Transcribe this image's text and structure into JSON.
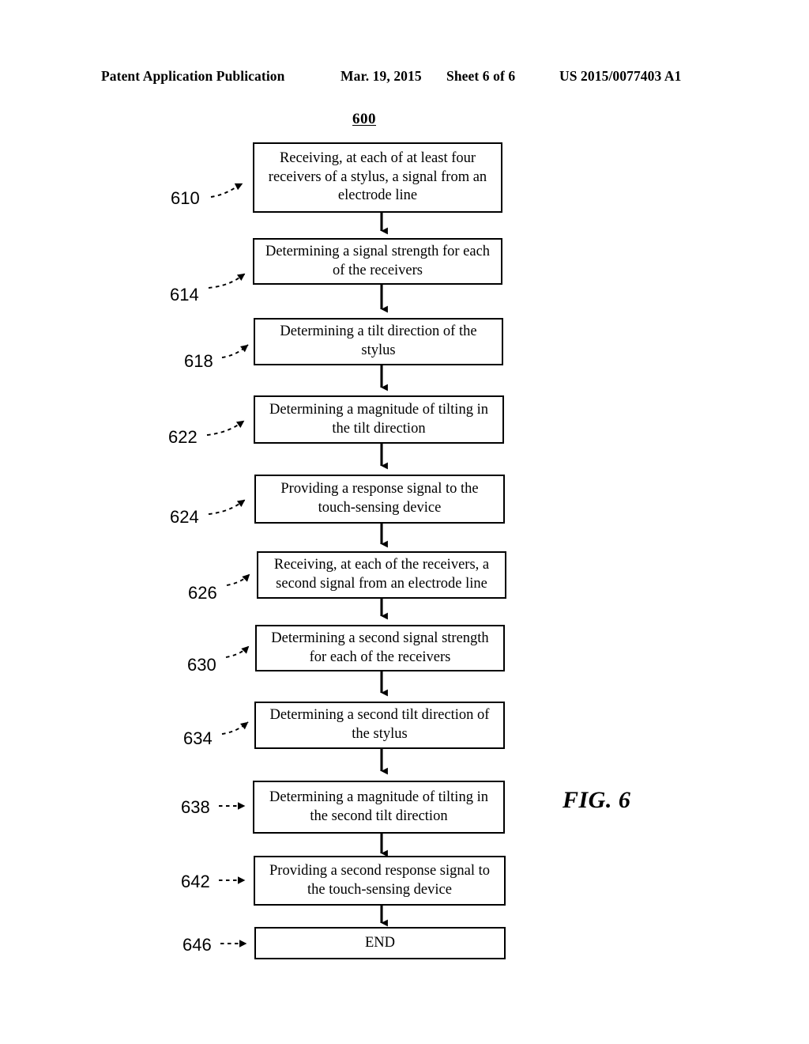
{
  "header": {
    "left": "Patent Application Publication",
    "date": "Mar. 19, 2015",
    "sheet": "Sheet 6 of 6",
    "publication_number": "US 2015/0077403 A1"
  },
  "figure": {
    "id_label": "600",
    "caption": "FIG. 6",
    "type": "flowchart",
    "orientation": "vertical-top-to-bottom"
  },
  "flowchart": {
    "steps": [
      {
        "ref": "610",
        "text": "Receiving, at each of at least four receivers of a stylus, a signal from an electrode line",
        "leader": "curved"
      },
      {
        "ref": "614",
        "text": "Determining a signal strength for each of the receivers",
        "leader": "curved"
      },
      {
        "ref": "618",
        "text": "Determining a tilt direction of the stylus",
        "leader": "curved"
      },
      {
        "ref": "622",
        "text": "Determining a magnitude of tilting in the tilt direction",
        "leader": "curved"
      },
      {
        "ref": "624",
        "text": "Providing a response signal to the touch-sensing device",
        "leader": "curved"
      },
      {
        "ref": "626",
        "text": "Receiving, at each of the receivers, a second signal from an electrode line",
        "leader": "curved"
      },
      {
        "ref": "630",
        "text": "Determining a second signal strength for each of the receivers",
        "leader": "curved"
      },
      {
        "ref": "634",
        "text": "Determining a second tilt direction of the stylus",
        "leader": "curved"
      },
      {
        "ref": "638",
        "text": "Determining a magnitude of tilting in the second tilt direction",
        "leader": "straight"
      },
      {
        "ref": "642",
        "text": "Providing a second response signal to the touch-sensing device",
        "leader": "straight"
      },
      {
        "ref": "646",
        "text": "END",
        "leader": "straight"
      }
    ]
  },
  "colors": {
    "background": "#ffffff",
    "ink": "#000000"
  }
}
